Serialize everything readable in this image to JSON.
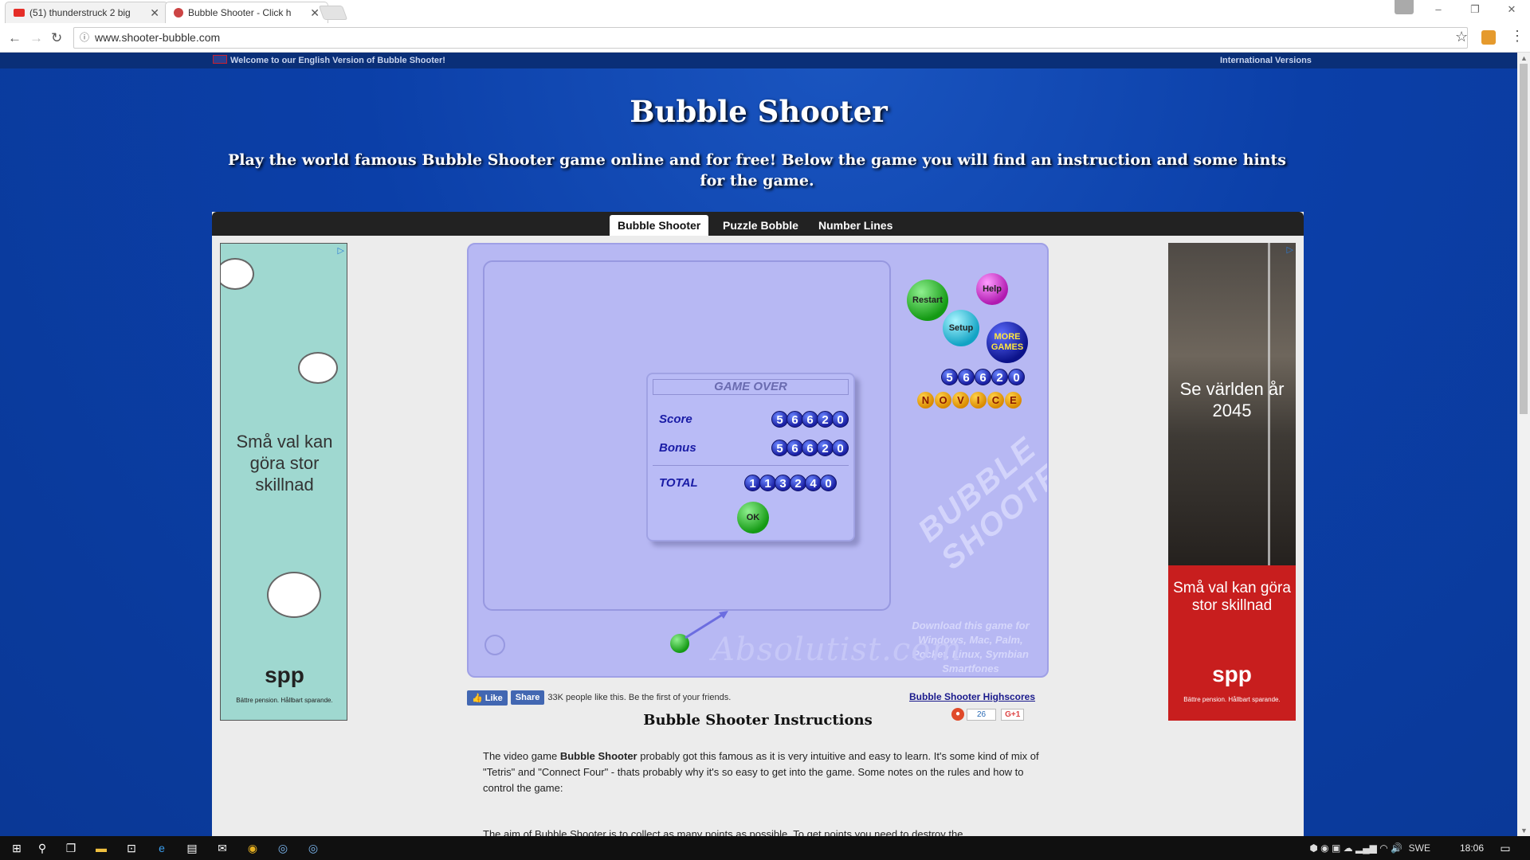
{
  "browser": {
    "tabs": [
      {
        "title": "(51) thunderstruck 2 big",
        "icon": "youtube-icon"
      },
      {
        "title": "Bubble Shooter - Click h",
        "icon": "bubble-shooter-favicon"
      }
    ],
    "url": "www.shooter-bubble.com",
    "window_buttons": [
      "–",
      "❐",
      "✕"
    ]
  },
  "page": {
    "welcome": "Welcome to our English Version of Bubble Shooter!",
    "international": "International Versions",
    "title": "Bubble Shooter",
    "subtitle": "Play the world famous Bubble Shooter game online and for free! Below the game you will find an instruction and some hints for the game.",
    "game_tabs": [
      "Bubble Shooter",
      "Puzzle Bobble",
      "Number Lines"
    ]
  },
  "ads": {
    "left": {
      "text": "Små val kan göra stor skillnad",
      "brand": "spp",
      "tagline": "Bättre pension. Hållbart sparande."
    },
    "right": {
      "headline": "Se världen år 2045",
      "text": "Små val kan göra stor skillnad",
      "brand": "spp",
      "tagline": "Bättre pension. Hållbart sparande."
    }
  },
  "game": {
    "buttons": {
      "restart": "Restart",
      "help": "Help",
      "setup": "Setup",
      "more_games": "MORE GAMES",
      "ok": "OK"
    },
    "score_side": "56620",
    "rank": "NOVICE",
    "dialog": {
      "header": "GAME OVER",
      "score_label": "Score",
      "score": "56620",
      "bonus_label": "Bonus",
      "bonus": "56620",
      "total_label": "TOTAL",
      "total": "113240"
    },
    "watermark": "BUBBLE SHOOTER",
    "download_text": "Download this game for Windows, Mac, Palm, Pocket, Linux, Symbian Smartfones",
    "absolutist": "Absolutist.com"
  },
  "social": {
    "like": "Like",
    "share": "Share",
    "count_text": "33K people like this. Be the first of your friends.",
    "highscores": "Bubble Shooter Highscores",
    "share_count": "26",
    "gplus": "G+1"
  },
  "instructions": {
    "title": "Bubble Shooter Instructions",
    "p1_before": "The video game ",
    "p1_bold": "Bubble Shooter",
    "p1_after": " probably got this famous as it is very intuitive and easy to learn. It's some kind of mix of \"Tetris\" and \"Connect Four\" - thats probably why it's so easy to get into the game. Some notes on the rules and how to control the game:",
    "p2": "The aim of Bubble Shooter is to collect as many points as possible. To get points you need to destroy the"
  },
  "taskbar": {
    "language": "SWE",
    "time": "18:06"
  },
  "colors": {
    "page_blue": "#0b3fa8",
    "game_bg": "#b7b8f3",
    "digit_blue": "#1a1fa3",
    "ad_red": "#c81e1e"
  }
}
